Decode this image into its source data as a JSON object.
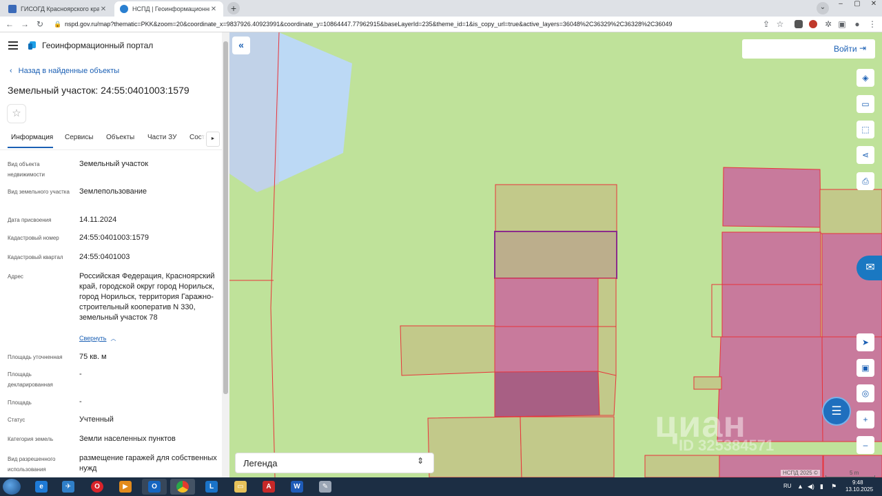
{
  "browser": {
    "tabs": [
      {
        "title": "ГИСОГД Красноярского края"
      },
      {
        "title": "НСПД | Геоинформационный п"
      }
    ],
    "new_tab": "+",
    "url": "nspd.gov.ru/map?thematic=PKK&zoom=20&coordinate_x=9837926.40923991&coordinate_y=10864447.77962915&baseLayerId=235&theme_id=1&is_copy_url=true&active_layers=36048%2C36329%2C36328%2C36049"
  },
  "panel": {
    "portal_title": "Геоинформационный портал",
    "back_link": "Назад в найденные объекты",
    "object_title": "Земельный участок: 24:55:0401003:1579",
    "tabs": [
      {
        "label": "Информация"
      },
      {
        "label": "Сервисы"
      },
      {
        "label": "Объекты"
      },
      {
        "label": "Части ЗУ"
      },
      {
        "label": "Соста"
      }
    ],
    "properties": [
      {
        "label": "Вид объекта недвижимости",
        "value": "Земельный участок"
      },
      {
        "label": "Вид земельного участка",
        "value": "Землепользование"
      },
      {
        "label": "Дата присвоения",
        "value": "14.11.2024"
      },
      {
        "label": "Кадастровый номер",
        "value": "24:55:0401003:1579"
      },
      {
        "label": "Кадастровый квартал",
        "value": "24:55:0401003"
      },
      {
        "label": "Адрес",
        "value": "Российская Федерация, Красноярский край, городской округ город Норильск, город Норильск, территория Гаражно-строительный кооператив N 330, земельный участок 78"
      },
      {
        "label": "Площадь уточненная",
        "value": "75 кв. м"
      },
      {
        "label": "Площадь декларированная",
        "value": "-"
      },
      {
        "label": "Площадь",
        "value": "-"
      },
      {
        "label": "Статус",
        "value": "Учтенный"
      },
      {
        "label": "Категория земель",
        "value": "Земли населенных пунктов"
      },
      {
        "label": "Вид разрешенного использования",
        "value": "размещение гаражей для собственных нужд"
      }
    ],
    "collapse_link": "Свернуть"
  },
  "map": {
    "login_label": "Войти",
    "legend_label": "Легенда",
    "copyright": "НСПД 2025 ©",
    "scale": "5 m",
    "watermark": "циан",
    "watermark_id": "ID 325384571",
    "colors": {
      "background": "#bfe29a",
      "water": "#bcd9f5",
      "parcel_pink": "#c87a9c",
      "parcel_tan": "#c2c98a",
      "boundary": "#e8333a",
      "selected": "#8b2a8c"
    }
  },
  "taskbar": {
    "lang": "RU",
    "time": "9:48",
    "date": "13.10.2025"
  }
}
